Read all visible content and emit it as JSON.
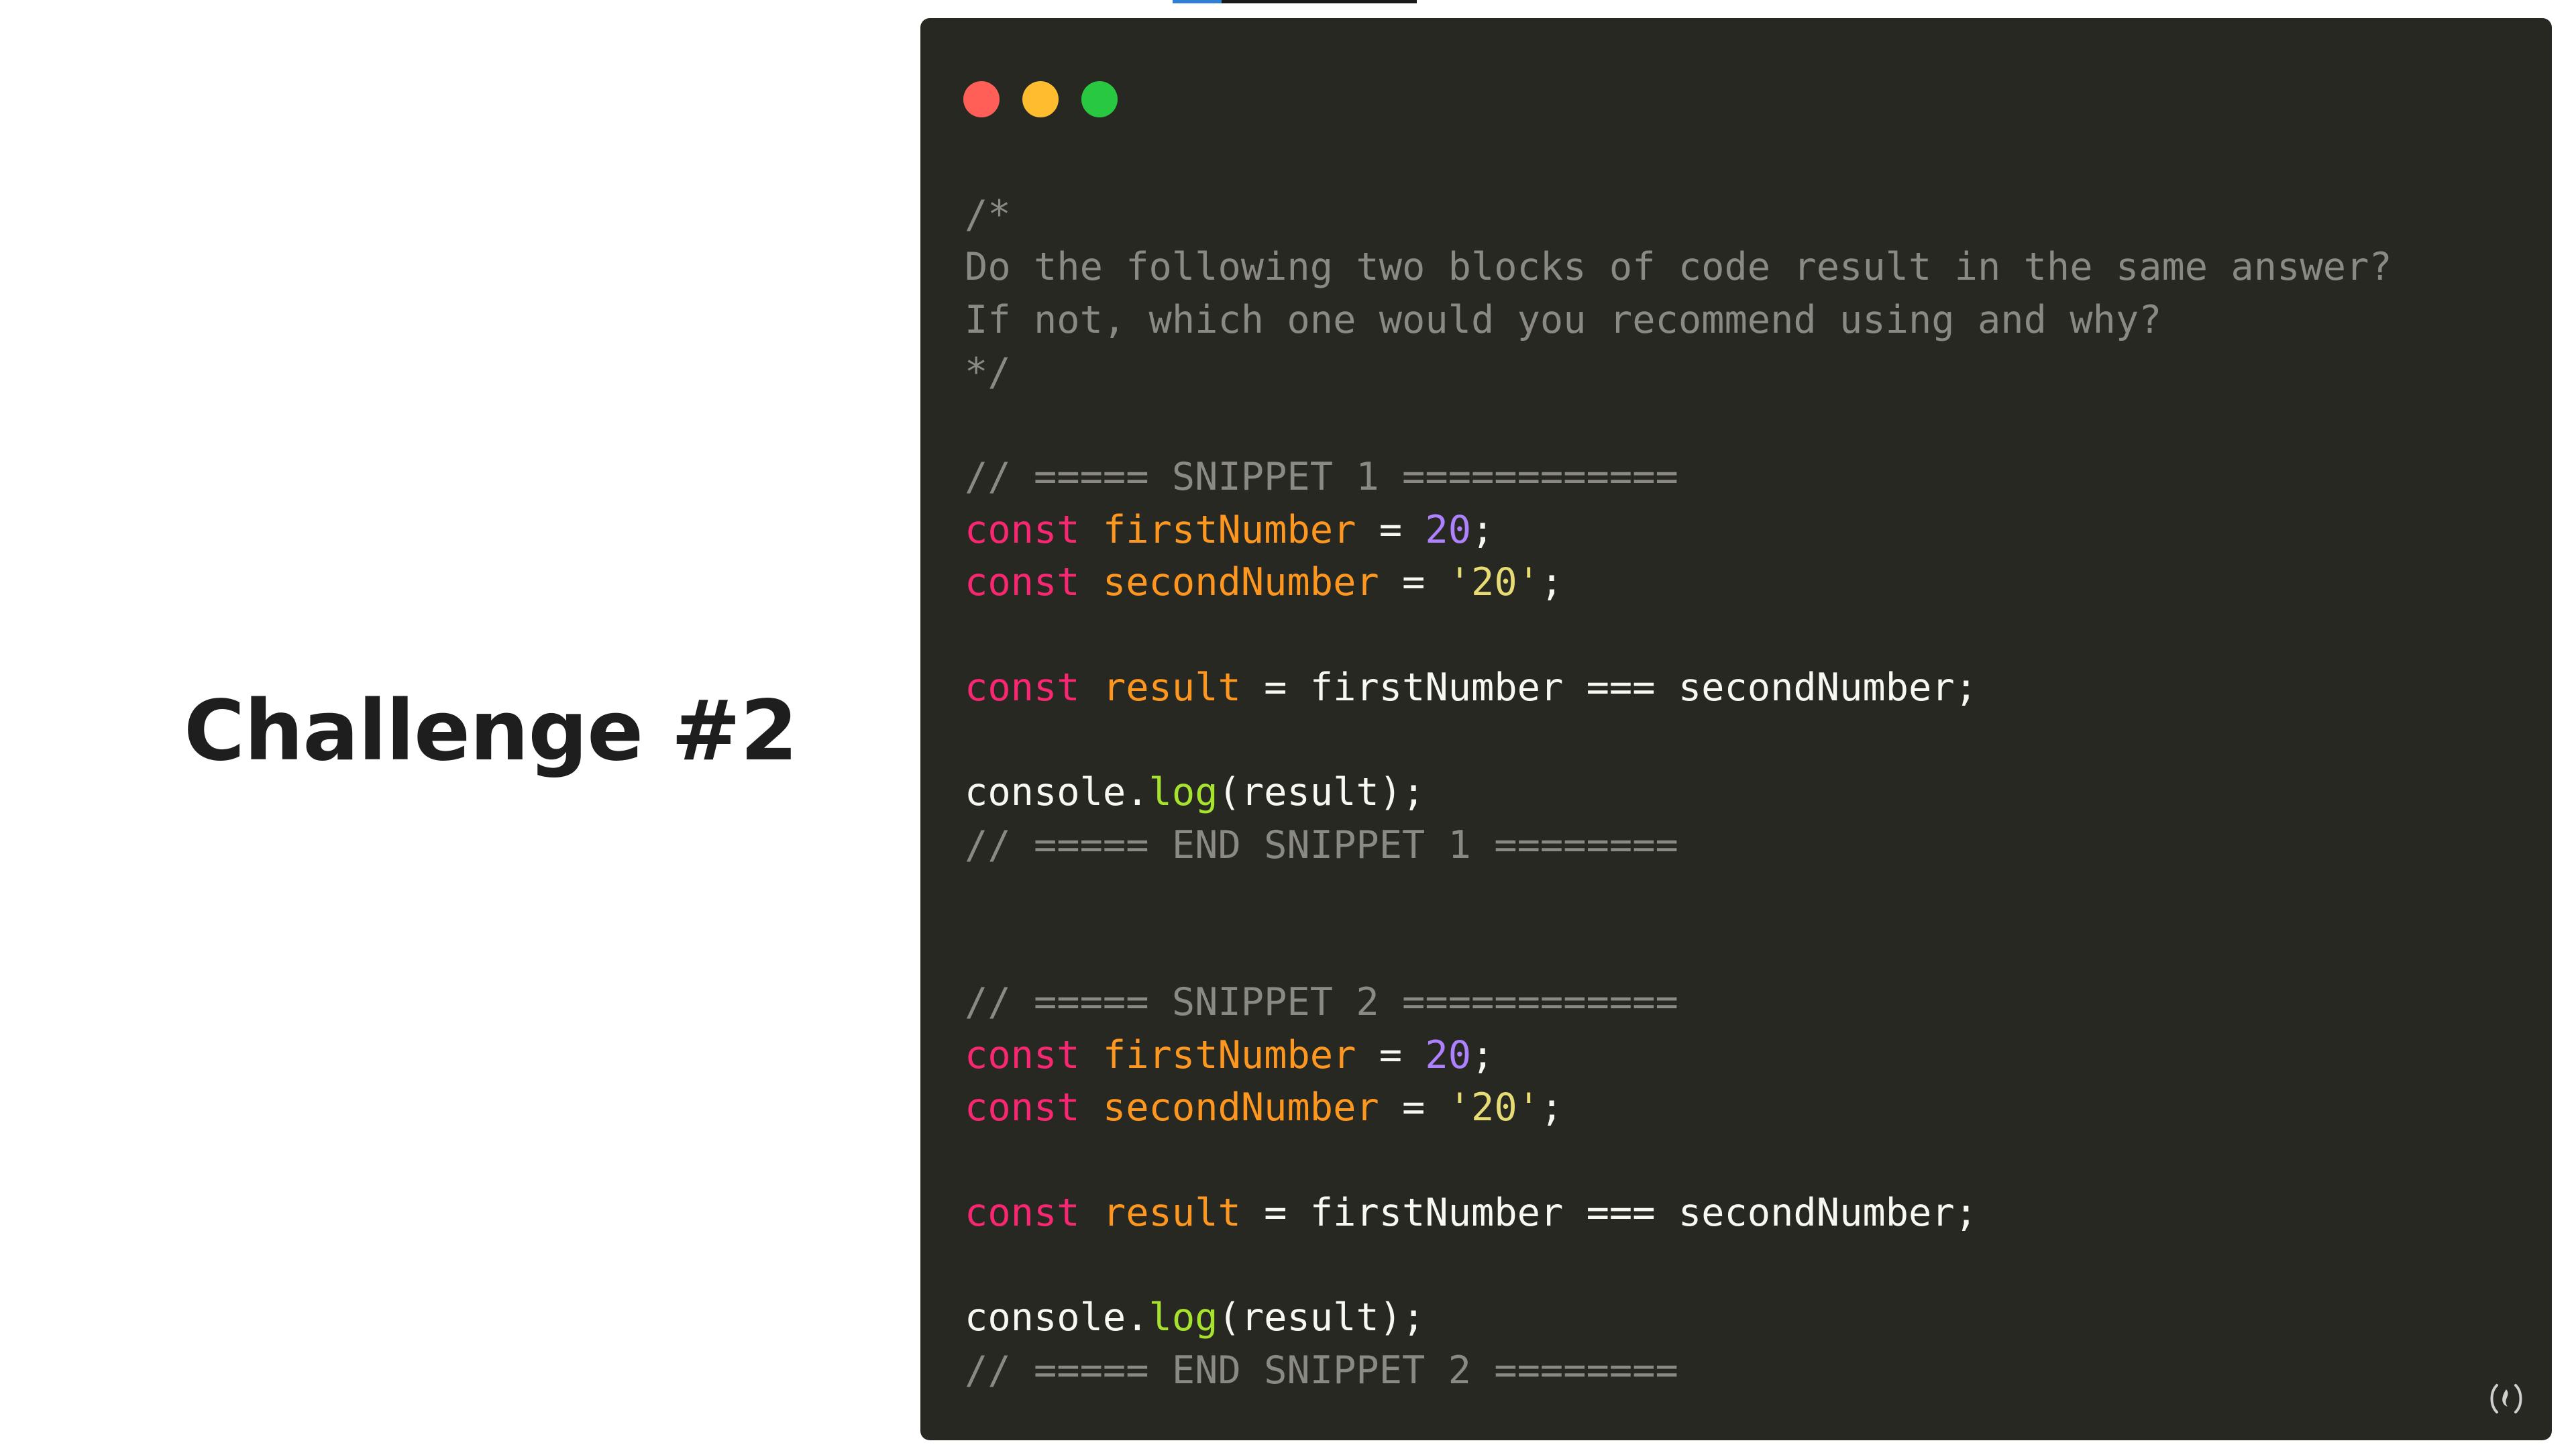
{
  "slide": {
    "title": "Challenge #2"
  },
  "progress": {
    "fraction": 0.2
  },
  "window": {
    "controls": [
      {
        "name": "close-button",
        "color": "#ff5f57"
      },
      {
        "name": "minimize-button",
        "color": "#febc2e"
      },
      {
        "name": "maximize-button",
        "color": "#28c840"
      }
    ]
  },
  "code": {
    "lines": [
      [
        {
          "t": "comment",
          "v": "/*"
        }
      ],
      [
        {
          "t": "comment",
          "v": "Do the following two blocks of code result in the same answer?"
        }
      ],
      [
        {
          "t": "comment",
          "v": "If not, which one would you recommend using and why?"
        }
      ],
      [
        {
          "t": "comment",
          "v": "*/"
        }
      ],
      [],
      [
        {
          "t": "comment",
          "v": "// ===== SNIPPET 1 ============"
        }
      ],
      [
        {
          "t": "keyword",
          "v": "const"
        },
        {
          "t": "plain",
          "v": " "
        },
        {
          "t": "var",
          "v": "firstNumber"
        },
        {
          "t": "plain",
          "v": " = "
        },
        {
          "t": "num",
          "v": "20"
        },
        {
          "t": "plain",
          "v": ";"
        }
      ],
      [
        {
          "t": "keyword",
          "v": "const"
        },
        {
          "t": "plain",
          "v": " "
        },
        {
          "t": "var",
          "v": "secondNumber"
        },
        {
          "t": "plain",
          "v": " = "
        },
        {
          "t": "str",
          "v": "'20'"
        },
        {
          "t": "plain",
          "v": ";"
        }
      ],
      [],
      [
        {
          "t": "keyword",
          "v": "const"
        },
        {
          "t": "plain",
          "v": " "
        },
        {
          "t": "var",
          "v": "result"
        },
        {
          "t": "plain",
          "v": " = firstNumber === secondNumber;"
        }
      ],
      [],
      [
        {
          "t": "plain",
          "v": "console."
        },
        {
          "t": "fn",
          "v": "log"
        },
        {
          "t": "plain",
          "v": "(result);"
        }
      ],
      [
        {
          "t": "comment",
          "v": "// ===== END SNIPPET 1 ========"
        }
      ],
      [],
      [],
      [
        {
          "t": "comment",
          "v": "// ===== SNIPPET 2 ============"
        }
      ],
      [
        {
          "t": "keyword",
          "v": "const"
        },
        {
          "t": "plain",
          "v": " "
        },
        {
          "t": "var",
          "v": "firstNumber"
        },
        {
          "t": "plain",
          "v": " = "
        },
        {
          "t": "num",
          "v": "20"
        },
        {
          "t": "plain",
          "v": ";"
        }
      ],
      [
        {
          "t": "keyword",
          "v": "const"
        },
        {
          "t": "plain",
          "v": " "
        },
        {
          "t": "var",
          "v": "secondNumber"
        },
        {
          "t": "plain",
          "v": " = "
        },
        {
          "t": "str",
          "v": "'20'"
        },
        {
          "t": "plain",
          "v": ";"
        }
      ],
      [],
      [
        {
          "t": "keyword",
          "v": "const"
        },
        {
          "t": "plain",
          "v": " "
        },
        {
          "t": "var",
          "v": "result"
        },
        {
          "t": "plain",
          "v": " = firstNumber === secondNumber;"
        }
      ],
      [],
      [
        {
          "t": "plain",
          "v": "console."
        },
        {
          "t": "fn",
          "v": "log"
        },
        {
          "t": "plain",
          "v": "(result);"
        }
      ],
      [
        {
          "t": "comment",
          "v": "// ===== END SNIPPET 2 ========"
        }
      ]
    ]
  },
  "colors": {
    "background": "#ffffff",
    "editor_background": "#272822",
    "title_text": "#1e1e1e",
    "comment": "#8a8a82",
    "keyword": "#f92672",
    "variable": "#fd971f",
    "number": "#ae81ff",
    "string": "#e6db74",
    "function": "#a6e22e",
    "plain": "#f8f8f2"
  },
  "icons": {
    "corner_logo": "freecodecamp-logo-icon"
  }
}
